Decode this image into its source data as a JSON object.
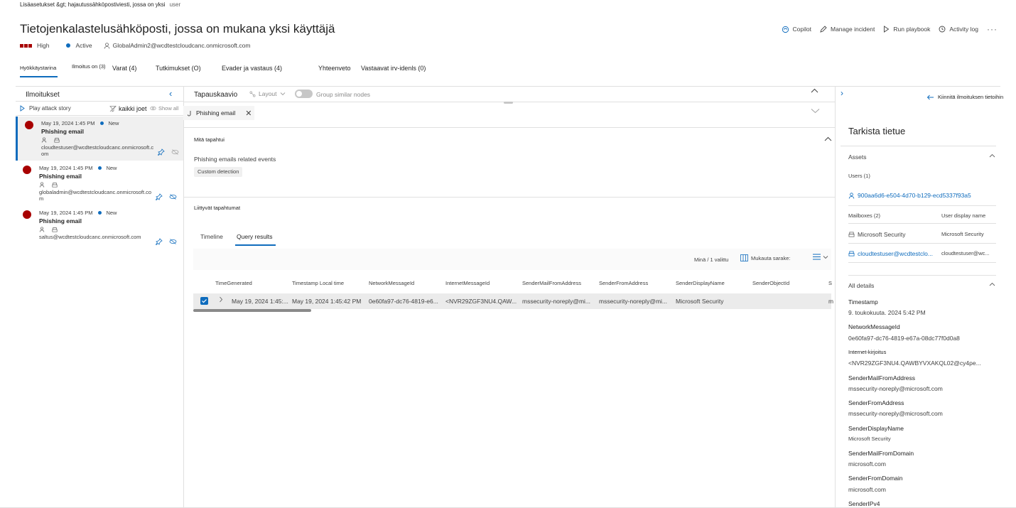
{
  "breadcrumb": {
    "path": "Lisäasetukset &gt; hajautussähköpostiviesti, jossa on yksi",
    "user": "user"
  },
  "incident": {
    "title": "Tietojenkalastelusähköposti, jossa on mukana yksi käyttäjä",
    "severity": "High",
    "status": "Active",
    "owner": "GlobalAdmin2@wcdtestcloudcanc.onmicrosoft.com"
  },
  "actions": {
    "copilot": "Copilot",
    "manage": "Manage incident",
    "playbook": "Run playbook",
    "activity": "Activity log",
    "more": "···"
  },
  "tabs": [
    {
      "label": "Hyökkäystarina"
    },
    {
      "label": "Ilmoitus on (3)"
    },
    {
      "label": "Varat (4)"
    },
    {
      "label": "Tutkimukset (O)"
    },
    {
      "label": "Evader ja vastaus (4)"
    },
    {
      "label": "Yhteenveto"
    },
    {
      "label": "Vastaavat irv-idenls (0)"
    }
  ],
  "alerts_panel": {
    "title": "Ilmoitukset",
    "play": "Play attack story",
    "kaikki": "kaikki joet",
    "show_all": "Show all",
    "alerts": [
      {
        "date": "May 19, 2024 1:45 PM",
        "status": "New",
        "name": "Phishing email",
        "mailbox": "cloudtestuser@wcdtestcloudcanc.onmicrosoft.com"
      },
      {
        "date": "May 19, 2024 1:45 PM",
        "status": "New",
        "name": "Phishing email",
        "mailbox": "globaladmin@wcdtestcloudcanc.onmicrosoft.com"
      },
      {
        "date": "May 19, 2024 1:45 PM",
        "status": "New",
        "name": "Phishing email",
        "mailbox": "saltus@wcdtestcloudcanc.onmicrosoft.com"
      }
    ]
  },
  "graph": {
    "title": "Tapauskaavio",
    "layout": "Layout",
    "group": "Group similar nodes"
  },
  "detail": {
    "tab": "Phishing email",
    "what_happened": "Mitä tapahtui",
    "events": "Phishing emails related events",
    "chip": "Custom detection",
    "related": "Liittyvät tapahtumat",
    "subtabs": [
      "Timeline",
      "Query results"
    ],
    "selected": "Minä / 1 valittu",
    "customize": "Mukauta sarake:",
    "columns": [
      "TimeGenerated",
      "Timestamp Local time",
      "NetworkMessageId",
      "InternetMessageId",
      "SenderMailFromAddress",
      "SenderFromAddress",
      "SenderDisplayName",
      "SenderObjectId",
      "S"
    ],
    "row": [
      "May 19, 2024 1:45:...",
      "May 19, 2024 1:45:42 PM",
      "0e60fa97-dc76-4819-e6...",
      "<NVR29ZGF3NU4.QAW...",
      "mssecurity-noreply@mi...",
      "mssecurity-noreply@mi...",
      "Microsoft Security",
      "",
      "m"
    ]
  },
  "record": {
    "pin_link": "Kiinnitä ilmoituksen tietoihin",
    "title": "Tarkista tietue",
    "assets": "Assets",
    "users_label": "Users (1)",
    "user": "900aa6d6-e504-4d70-b129-ecd5337f93a5",
    "mailboxes_label": "Mailboxes (2)",
    "display_name_label": "User display name",
    "mailboxes": [
      {
        "name": "Microsoft Security",
        "display": "Microsoft Security"
      },
      {
        "name": "cloudtestuser@wcdtestclo...",
        "display": "cloudtestuser@wc..."
      }
    ],
    "all_details": "All details",
    "details": [
      {
        "key": "Timestamp",
        "value": "9. toukokuuta. 2024 5:42 PM"
      },
      {
        "key": "NetworkMessageId",
        "value": "0e60fa97-dc76-4819-e67a-08dc77f0d0a8"
      },
      {
        "key": "Internet-kirjoitus",
        "value": "<NVR29ZGF3NU4.QAWBYVXAKQL02@cy4pe..."
      },
      {
        "key": "SenderMailFromAddress",
        "value": "mssecurity-noreply@microsoft.com"
      },
      {
        "key": "SenderFromAddress",
        "value": "mssecurity-noreply@microsoft.com"
      },
      {
        "key": "SenderDisplayName",
        "value": "Microsoft Security"
      },
      {
        "key": "SenderMailFromDomain",
        "value": "microsoft.com"
      },
      {
        "key": "SenderFromDomain",
        "value": "microsoft.com"
      },
      {
        "key": "SenderIPv4",
        "value": ""
      }
    ]
  },
  "colors": {
    "accent": "#0f6cbd",
    "severity_high": "#a80000"
  }
}
